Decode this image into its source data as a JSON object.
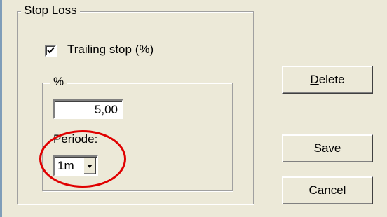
{
  "stop_loss": {
    "group_label": "Stop Loss",
    "trailing_stop": {
      "label": "Trailing stop (%)",
      "checked": true
    },
    "percent_group": {
      "label": "%",
      "value": "5,00",
      "periode_label": "Periode:",
      "periode_selected": "1m"
    }
  },
  "buttons": {
    "delete": {
      "accel": "D",
      "rest": "elete"
    },
    "save": {
      "accel": "S",
      "rest": "ave"
    },
    "cancel": {
      "accel": "C",
      "rest": "ancel"
    }
  },
  "colors": {
    "dialog_bg": "#ece9d8",
    "annotation": "#e00000"
  }
}
